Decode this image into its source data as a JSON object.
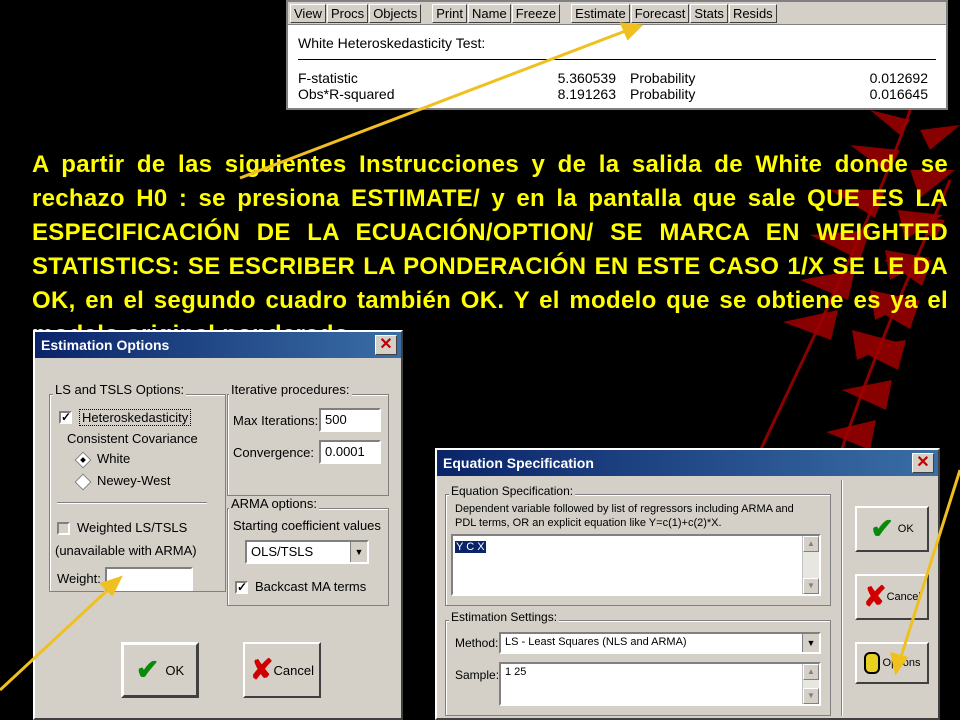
{
  "eviews": {
    "toolbar": [
      "View",
      "Procs",
      "Objects",
      "Print",
      "Name",
      "Freeze",
      "Estimate",
      "Forecast",
      "Stats",
      "Resids"
    ],
    "test_title": "White Heteroskedasticity Test:",
    "rows": [
      {
        "label": "F-statistic",
        "value": "5.360539",
        "prob_label": "Probability",
        "prob": "0.012692"
      },
      {
        "label": "Obs*R-squared",
        "value": "8.191263",
        "prob_label": "Probability",
        "prob": "0.016645"
      }
    ]
  },
  "paragraph": "A partir de las siguientes Instrucciones y de la salida de White donde se rechazo H0 : se presiona ESTIMATE/ y en la pantalla que sale QUE ES LA ESPECIFICACIÓN DE LA ECUACIÓN/OPTION/ SE MARCA EN WEIGHTED STATISTICS: SE ESCRIBER LA PONDERACIÓN EN ESTE CASO 1/X SE LE DA OK, en el segundo cuadro también OK. Y el modelo que se obtiene es ya el modelo original ponderado.",
  "estimation_options": {
    "title": "Estimation Options",
    "ls_group": "LS and TSLS Options:",
    "hetero": "Heteroskedasticity",
    "consistent_cov": "Consistent Covariance",
    "white": "White",
    "newey": "Newey-West",
    "weighted": "Weighted LS/TSLS",
    "unavailable": "(unavailable with ARMA)",
    "weight_label": "Weight:",
    "weight_value": "",
    "iter_group": "Iterative procedures:",
    "max_iter_label": "Max Iterations:",
    "max_iter_value": "500",
    "convergence_label": "Convergence:",
    "convergence_value": "0.0001",
    "arma_group": "ARMA options:",
    "start_coef": "Starting coefficient values",
    "start_coef_value": "OLS/TSLS",
    "backcast": "Backcast MA terms",
    "ok": "OK",
    "cancel": "Cancel",
    "hetero_checked": true,
    "backcast_checked": true,
    "weighted_checked": false
  },
  "equation_spec": {
    "title": "Equation Specification",
    "spec_group": "Equation Specification:",
    "spec_help": "Dependent variable followed by list of regressors including ARMA and PDL terms, OR an explicit equation like Y=c(1)+c(2)*X.",
    "spec_value": "Y C X",
    "settings_group": "Estimation Settings:",
    "method_label": "Method:",
    "method_value": "LS  -  Least Squares (NLS and ARMA)",
    "sample_label": "Sample:",
    "sample_value": "1 25",
    "ok": "OK",
    "cancel": "Cancel",
    "options": "Options"
  },
  "colors": {
    "highlight_text": "#ffff00",
    "arrow": "#f0c020",
    "titlebar": "#0a246a"
  }
}
